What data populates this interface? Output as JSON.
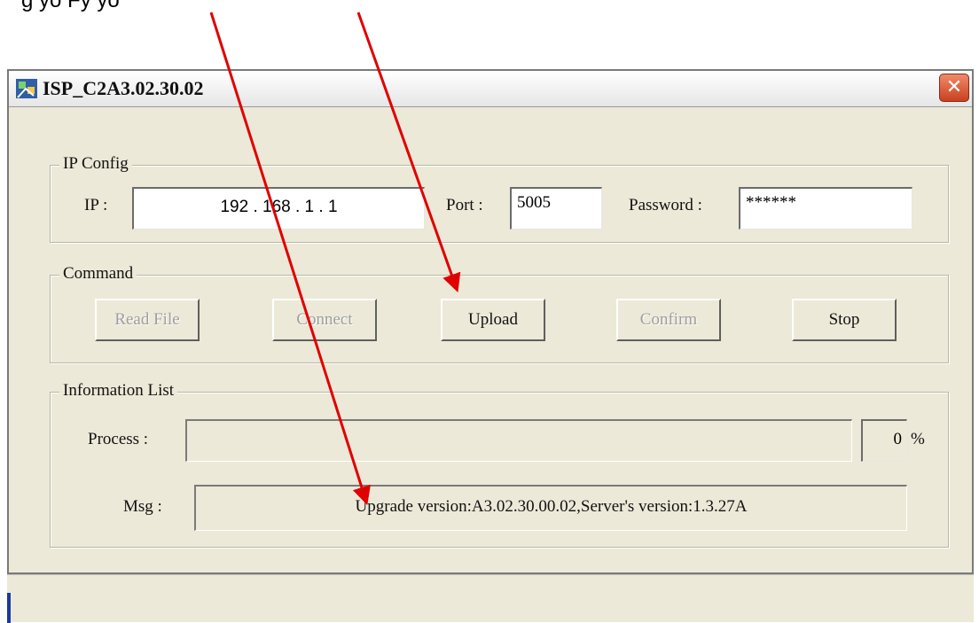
{
  "window": {
    "title": "ISP_C2A3.02.30.02",
    "close_glyph": "✕",
    "icon": "app-icon"
  },
  "ip_config": {
    "legend": "IP Config",
    "ip_label": "IP :",
    "ip_value": "192 . 168 . 1 . 1",
    "port_label": "Port :",
    "port_value": "5005",
    "password_label": "Password :",
    "password_value": "******"
  },
  "command": {
    "legend": "Command",
    "buttons": [
      {
        "label": "Read File",
        "enabled": false
      },
      {
        "label": "Connect",
        "enabled": false
      },
      {
        "label": "Upload",
        "enabled": true
      },
      {
        "label": "Confirm",
        "enabled": false
      },
      {
        "label": "Stop",
        "enabled": true
      }
    ]
  },
  "info": {
    "legend": "Information List",
    "process_label": "Process :",
    "percent_value": "0",
    "percent_sign": "%",
    "msg_label": "Msg :",
    "msg_value": "Upgrade version:A3.02.30.00.02,Server's version:1.3.27A"
  },
  "annotation": {
    "note": "g yo Fy yo",
    "arrow_color": "#e00000"
  }
}
